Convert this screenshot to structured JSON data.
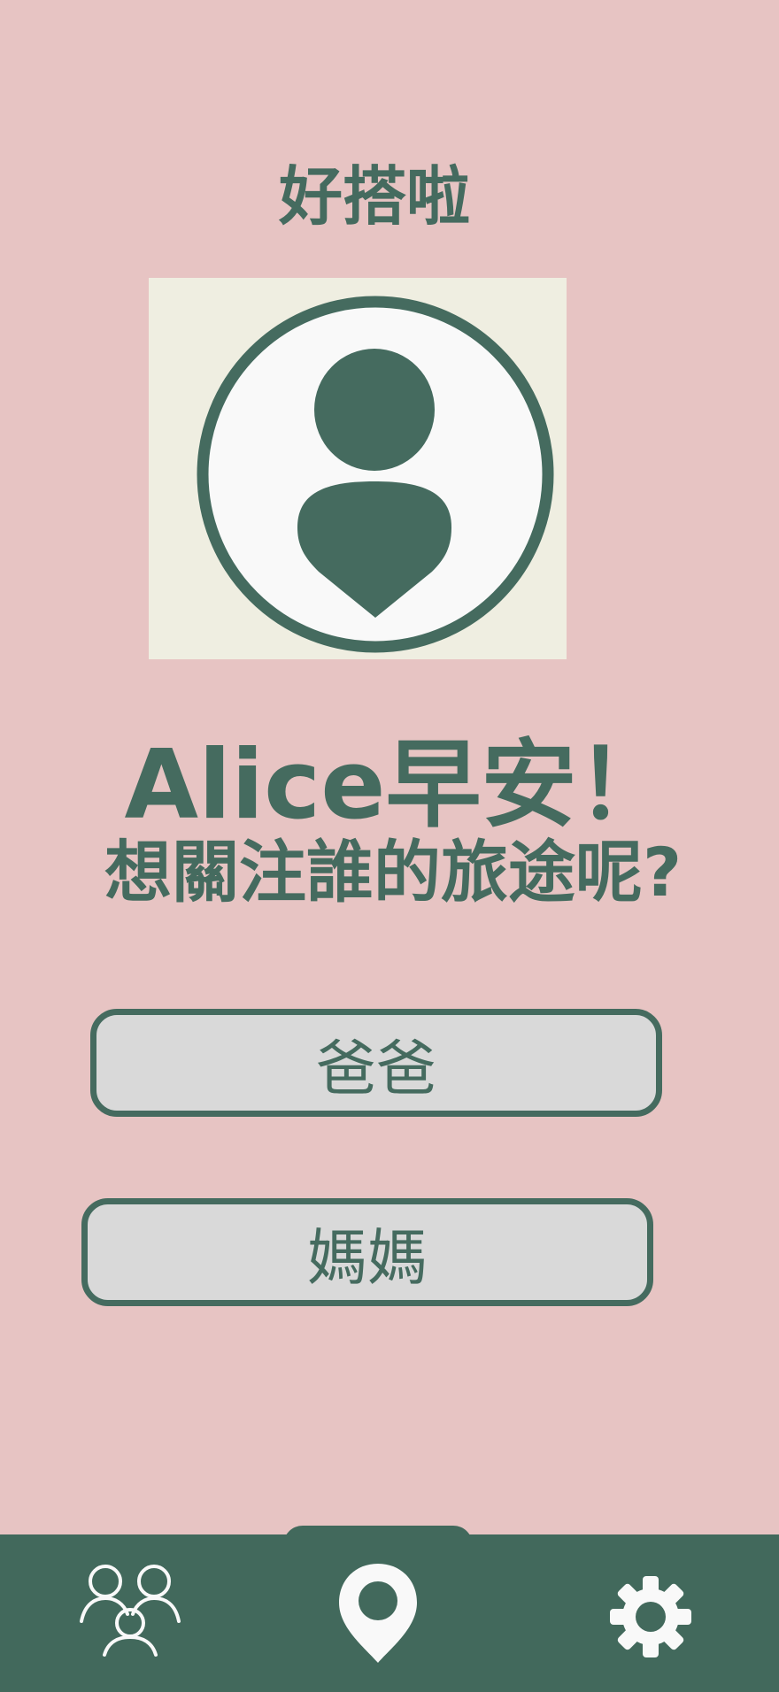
{
  "app": {
    "title": "好搭啦"
  },
  "profile": {
    "avatar_icon": "user-avatar-icon"
  },
  "greeting": {
    "text": "Alice早安！",
    "question": "想關注誰的旅途呢?"
  },
  "people": [
    {
      "label": "爸爸"
    },
    {
      "label": "媽媽"
    }
  ],
  "bottom_nav": {
    "items": [
      {
        "icon": "family-group-icon"
      },
      {
        "icon": "location-pin-icon"
      },
      {
        "icon": "gear-icon"
      }
    ]
  },
  "colors": {
    "background": "#e7c4c3",
    "primary": "#456b5f",
    "nav_background": "#42695c",
    "avatar_frame": "#efeee1",
    "button_fill": "#d9d9d9",
    "icon_light": "#f9f9f9"
  }
}
